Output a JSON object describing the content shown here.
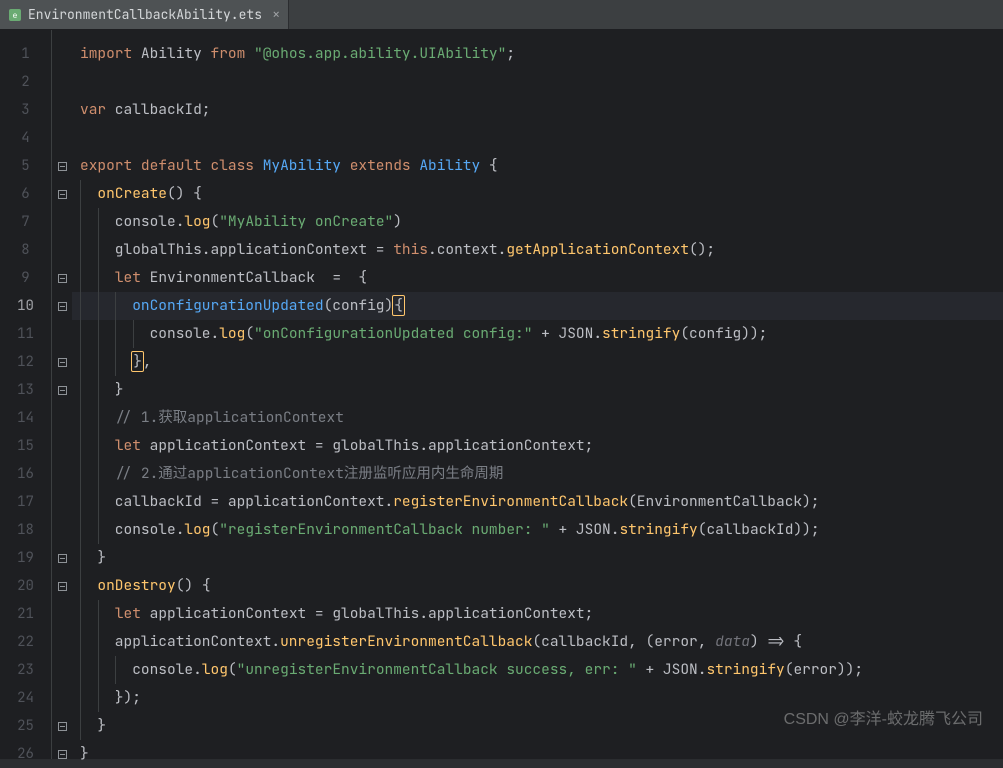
{
  "tab": {
    "filename": "EnvironmentCallbackAbility.ets",
    "close": "×"
  },
  "watermark": "CSDN @李洋-蛟龙腾飞公司",
  "activeLine": 10,
  "foldMarkers": {
    "1": "",
    "5": "⊟",
    "6": "⊟",
    "9": "⊟",
    "10": "⊟",
    "12": "⊟",
    "13": "⊟",
    "19": "⊟",
    "20": "⊟",
    "21": "",
    "25": "⊟",
    "26": "⊟"
  },
  "code": {
    "l1": {
      "t": [
        "import",
        " Ability ",
        "from",
        " ",
        "\"@ohos.app.ability.UIAbility\"",
        ";"
      ],
      "c": [
        "kw",
        "",
        "kw",
        "",
        "str",
        ""
      ]
    },
    "l2": {
      "t": [
        ""
      ],
      "c": [
        ""
      ]
    },
    "l3": {
      "t": [
        "var",
        " callbackId;"
      ],
      "c": [
        "kw",
        ""
      ]
    },
    "l4": {
      "t": [
        ""
      ],
      "c": [
        ""
      ]
    },
    "l5": {
      "t": [
        "export default class ",
        "MyAbility ",
        "extends ",
        "Ability ",
        "{"
      ],
      "c": [
        "kw",
        "cls",
        "kw",
        "cls",
        ""
      ]
    },
    "l6": {
      "t": [
        "  ",
        "onCreate",
        "() {"
      ],
      "c": [
        "",
        "fn",
        ""
      ]
    },
    "l7": {
      "t": [
        "    console.",
        "log",
        "(",
        "\"MyAbility onCreate\"",
        ")"
      ],
      "c": [
        "",
        "fn",
        "",
        "str",
        ""
      ]
    },
    "l8": {
      "t": [
        "    globalThis.applicationContext = ",
        "this",
        ".context.",
        "getApplicationContext",
        "();"
      ],
      "c": [
        "",
        "kw",
        "",
        "fn",
        ""
      ]
    },
    "l9": {
      "t": [
        "    ",
        "let",
        " EnvironmentCallback  =  {"
      ],
      "c": [
        "",
        "kw",
        ""
      ]
    },
    "l10": {
      "t": [
        "      ",
        "onConfigurationUpdated",
        "(config)",
        "{"
      ],
      "c": [
        "",
        "fn2",
        "",
        "brace-match"
      ]
    },
    "l11": {
      "t": [
        "        console.",
        "log",
        "(",
        "\"onConfigurationUpdated config:\"",
        " + JSON.",
        "stringify",
        "(config));"
      ],
      "c": [
        "",
        "fn",
        "",
        "str",
        "",
        "fn",
        ""
      ]
    },
    "l12": {
      "t": [
        "      ",
        "}",
        ","
      ],
      "c": [
        "",
        "brace-match",
        ""
      ]
    },
    "l13": {
      "t": [
        "    }"
      ],
      "c": [
        ""
      ]
    },
    "l14": {
      "t": [
        "    ",
        "// 1.获取applicationContext"
      ],
      "c": [
        "",
        "cmt"
      ]
    },
    "l15": {
      "t": [
        "    ",
        "let",
        " applicationContext = globalThis.applicationContext;"
      ],
      "c": [
        "",
        "kw",
        ""
      ]
    },
    "l16": {
      "t": [
        "    ",
        "// 2.通过applicationContext注册监听应用内生命周期"
      ],
      "c": [
        "",
        "cmt"
      ]
    },
    "l17": {
      "t": [
        "    callbackId = applicationContext.",
        "registerEnvironmentCallback",
        "(EnvironmentCallback);"
      ],
      "c": [
        "",
        "fn",
        ""
      ]
    },
    "l18": {
      "t": [
        "    console.",
        "log",
        "(",
        "\"registerEnvironmentCallback number: \"",
        " + JSON.",
        "stringify",
        "(callbackId));"
      ],
      "c": [
        "",
        "fn",
        "",
        "str",
        "",
        "fn",
        ""
      ]
    },
    "l19": {
      "t": [
        "  }"
      ],
      "c": [
        ""
      ]
    },
    "l20": {
      "t": [
        "  ",
        "onDestroy",
        "() {"
      ],
      "c": [
        "",
        "fn",
        ""
      ]
    },
    "l21": {
      "t": [
        "    ",
        "let",
        " applicationContext = globalThis.applicationContext;"
      ],
      "c": [
        "",
        "kw",
        ""
      ]
    },
    "l22": {
      "t": [
        "    applicationContext.",
        "unregisterEnvironmentCallback",
        "(callbackId, (error, ",
        "data",
        ") => {"
      ],
      "c": [
        "",
        "fn",
        "",
        "param",
        ""
      ]
    },
    "l23": {
      "t": [
        "      console.",
        "log",
        "(",
        "\"unregisterEnvironmentCallback success, err: \"",
        " + JSON.",
        "stringify",
        "(error));"
      ],
      "c": [
        "",
        "fn",
        "",
        "str",
        "",
        "fn",
        ""
      ]
    },
    "l24": {
      "t": [
        "    });"
      ],
      "c": [
        ""
      ]
    },
    "l25": {
      "t": [
        "  }"
      ],
      "c": [
        ""
      ]
    },
    "l26": {
      "t": [
        "}"
      ],
      "c": [
        ""
      ]
    }
  }
}
